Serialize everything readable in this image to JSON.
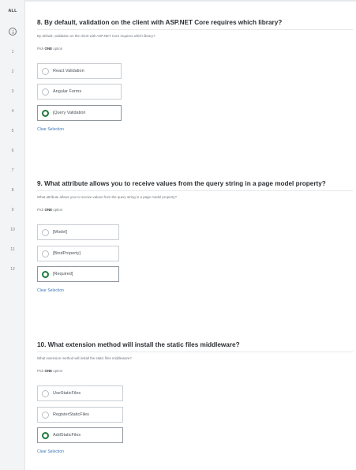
{
  "sidebar": {
    "all_label": "ALL",
    "numbers": [
      "1",
      "2",
      "3",
      "4",
      "5",
      "6",
      "7",
      "8",
      "9",
      "10",
      "11",
      "12"
    ]
  },
  "questions": [
    {
      "title": "8. By default, validation on the client with ASP.NET Core requires which library?",
      "subtitle": "By default, validation on the client with ASP.NET Core requires which library?",
      "pick_prefix": "Pick",
      "pick_bold": "ONE",
      "pick_suffix": "option",
      "options": [
        {
          "label": "React Validation",
          "selected": false
        },
        {
          "label": "Angular Forms",
          "selected": false
        },
        {
          "label": "jQuery Validation",
          "selected": true
        }
      ],
      "clear_label": "Clear Selection"
    },
    {
      "title": "9. What attribute allows you to receive values from the query string in a page model property?",
      "subtitle": "What attribute allows you to receive values from the query string in a page model property?",
      "pick_prefix": "Pick",
      "pick_bold": "ONE",
      "pick_suffix": "option",
      "options": [
        {
          "label": "[Model]",
          "selected": false
        },
        {
          "label": "[BindProperty]",
          "selected": false
        },
        {
          "label": "[Required]",
          "selected": true
        }
      ],
      "clear_label": "Clear Selection"
    },
    {
      "title": "10. What extension method will install the static files middleware?",
      "subtitle": "What extension method will install the static files middleware?",
      "pick_prefix": "Pick",
      "pick_bold": "ONE",
      "pick_suffix": "option",
      "options": [
        {
          "label": "UseStaticFiles",
          "selected": false
        },
        {
          "label": "RegisterStaticFiles",
          "selected": false
        },
        {
          "label": "AddStaticFiles",
          "selected": true
        }
      ],
      "clear_label": "Clear Selection"
    }
  ],
  "colors": {
    "selected_radio": "#1f7a3d",
    "link": "#3f79b8",
    "sidebar_bg": "#f2f4f6"
  }
}
